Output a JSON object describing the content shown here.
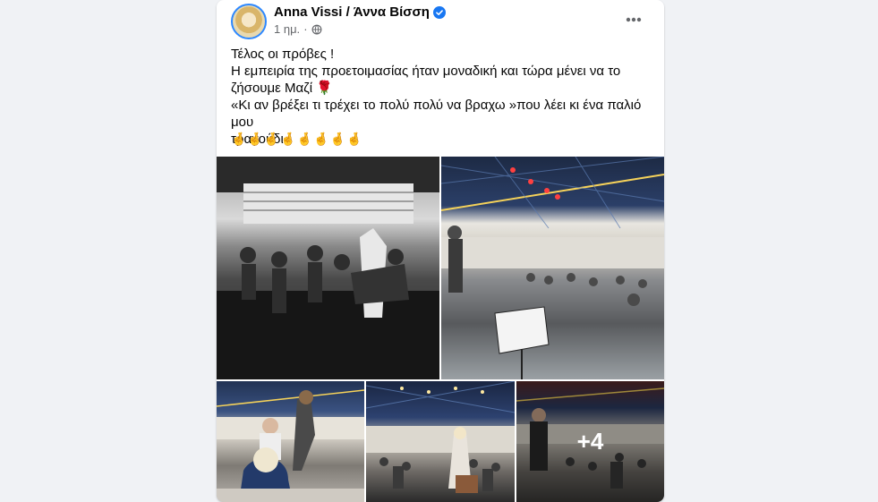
{
  "post": {
    "author": "Anna Vissi / Άννα Βίσση",
    "time": "1 ημ.",
    "lines": [
      "Τέλος οι πρόβες !",
      "Η εμπειρία της προετοιμασίας ήταν μοναδική και τώρα μένει να το",
      "ζήσουμε Μαζί 🌹",
      "«Κι αν βρέξει τι τρέχει το πολύ πολύ να βραχω »που λέει κι ένα παλιό μου",
      "τραγούδι"
    ],
    "emoji_line": "🤞🤞🤞🤞🤞🤞🤞🤞"
  },
  "photos": {
    "more_count": "+4"
  },
  "icons": {
    "verified": "verified-badge-icon",
    "privacy": "globe-icon",
    "options": "more-options-icon"
  },
  "colors": {
    "accent": "#1877f2",
    "secondary_text": "#65676b"
  }
}
